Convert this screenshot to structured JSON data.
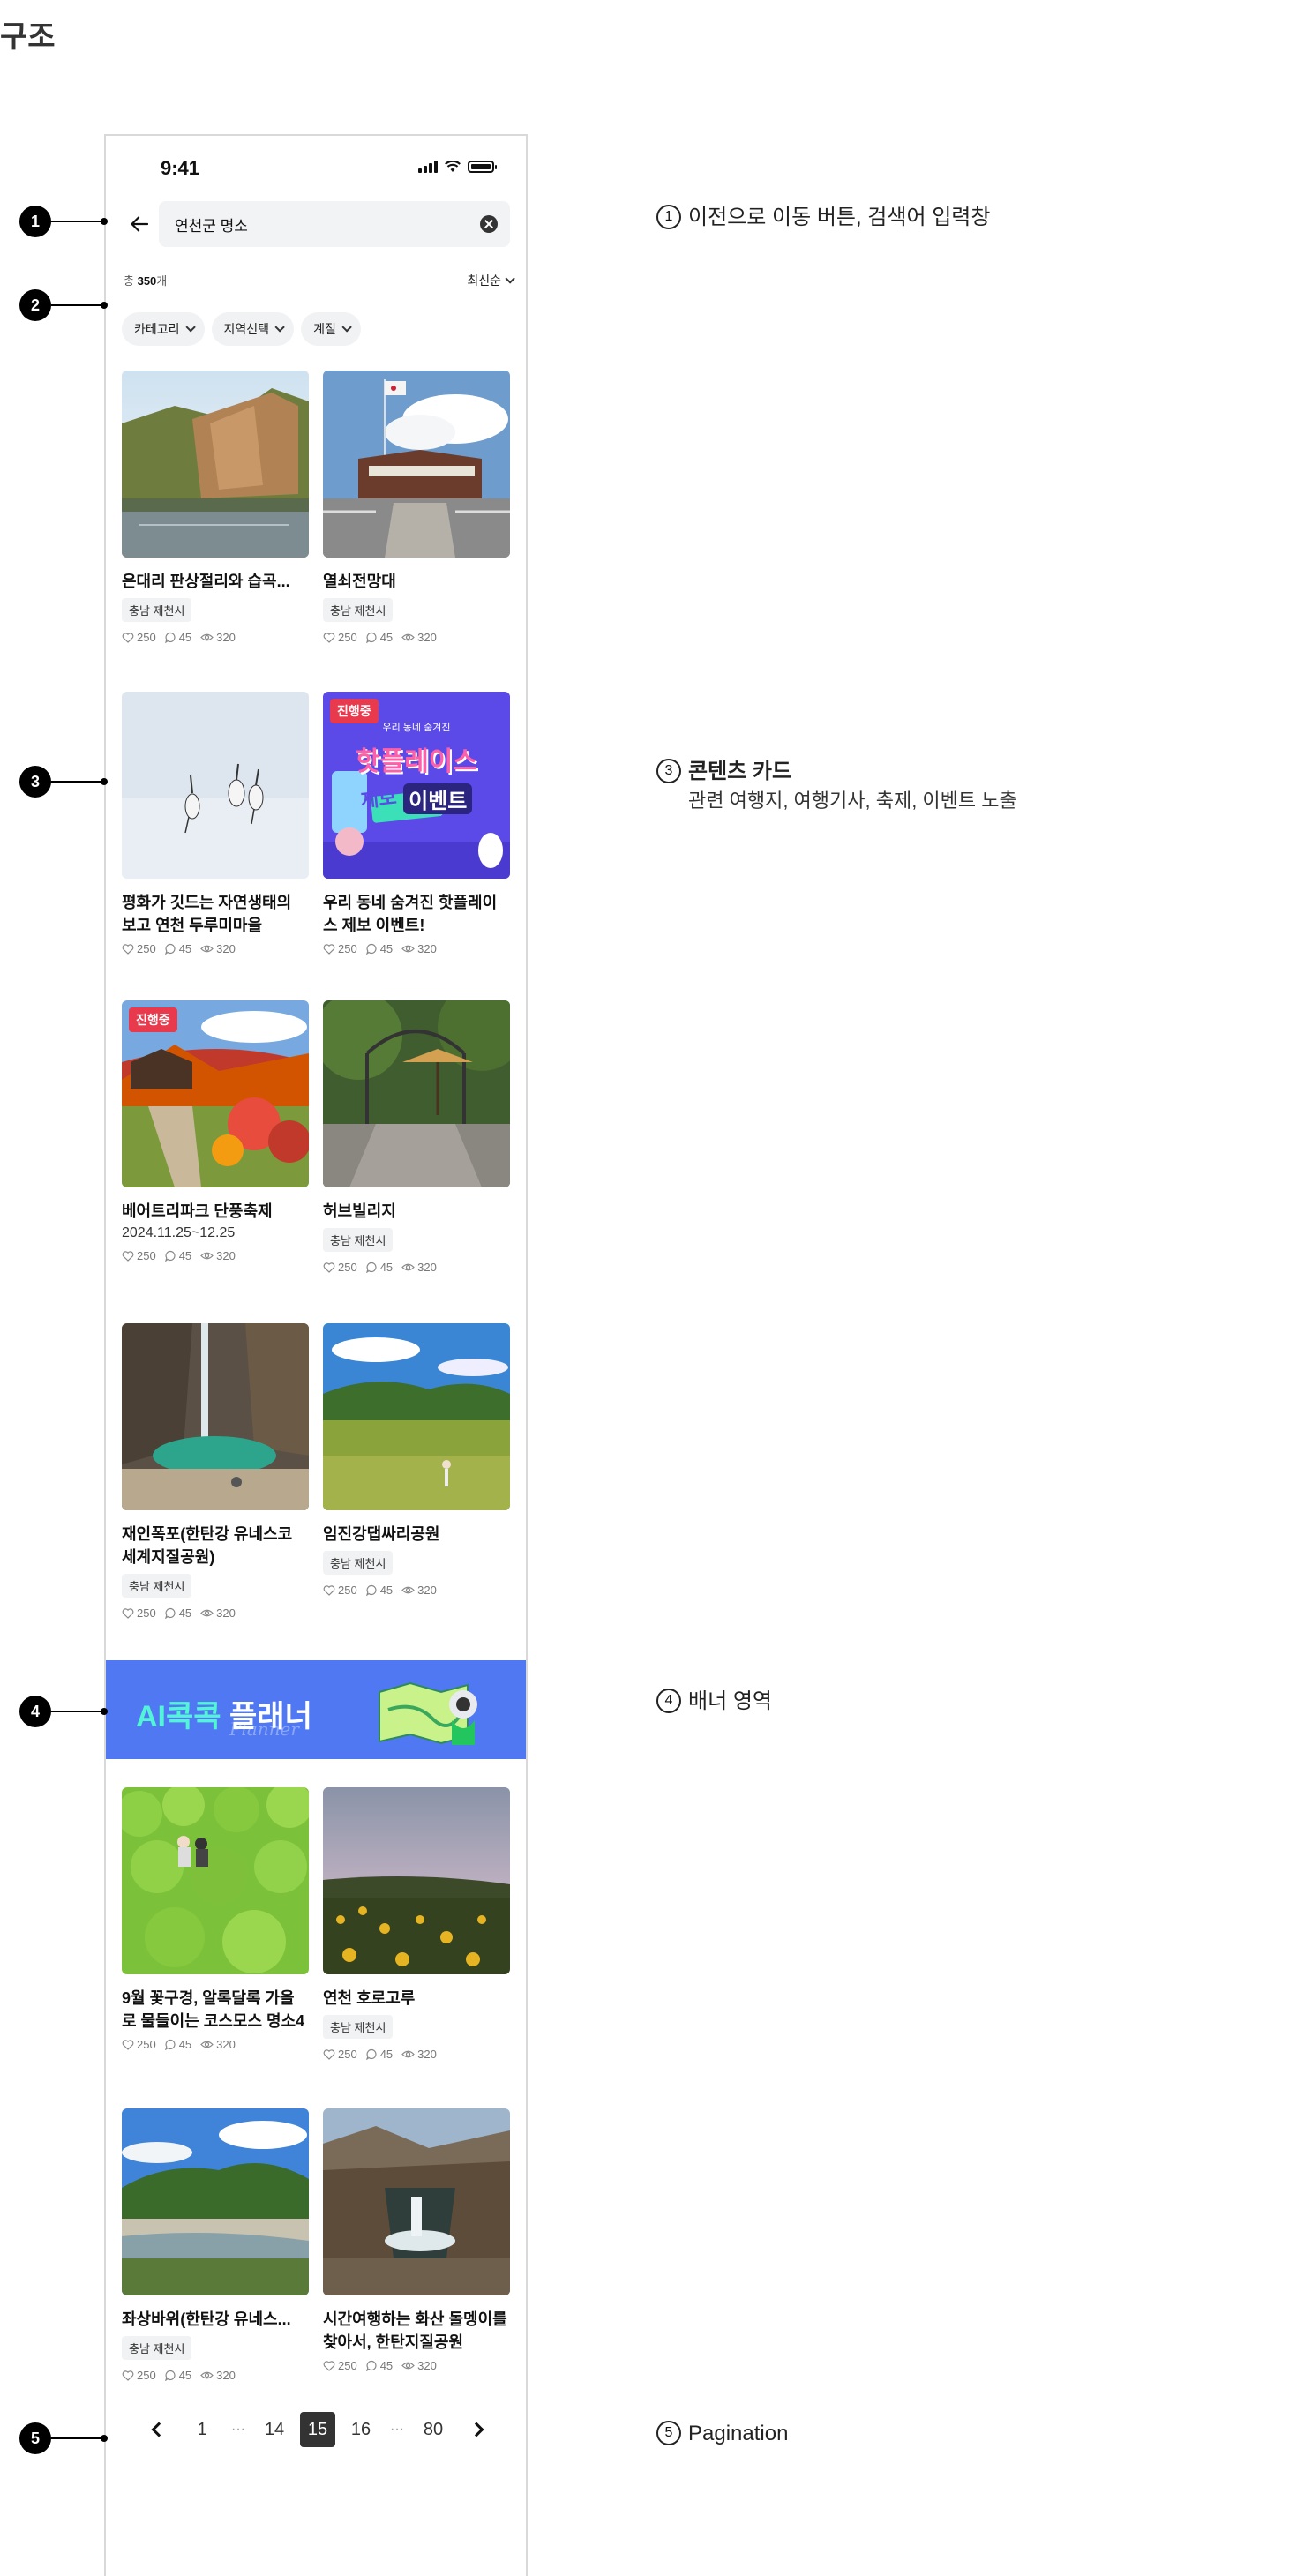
{
  "page": {
    "title": "구조"
  },
  "status_bar": {
    "time": "9:41"
  },
  "search": {
    "value": "연천군 명소"
  },
  "result": {
    "prefix": "총",
    "count": "350",
    "suffix": "개"
  },
  "sort": {
    "label": "최신순"
  },
  "filters": [
    {
      "label": "카테고리"
    },
    {
      "label": "지역선택"
    },
    {
      "label": "계절"
    }
  ],
  "cards": [
    {
      "title": "은대리 판상절리와 습곡...",
      "location": "충남 제천시",
      "likes": "250",
      "comments": "45",
      "views": "320"
    },
    {
      "title": "열쇠전망대",
      "location": "충남 제천시",
      "likes": "250",
      "comments": "45",
      "views": "320"
    },
    {
      "title": "평화가 깃드는 자연생태의 보고 연천 두루미마을",
      "likes": "250",
      "comments": "45",
      "views": "320"
    },
    {
      "title": "우리 동네 숨겨진 핫플레이스 제보 이벤트!",
      "badge": "진행중",
      "likes": "250",
      "comments": "45",
      "views": "320"
    },
    {
      "title": "베어트리파크 단풍축제",
      "date": "2024.11.25~12.25",
      "badge": "진행중",
      "likes": "250",
      "comments": "45",
      "views": "320"
    },
    {
      "title": "허브빌리지",
      "location": "충남 제천시",
      "likes": "250",
      "comments": "45",
      "views": "320"
    },
    {
      "title": "재인폭포(한탄강 유네스코 세계지질공원)",
      "location": "충남 제천시",
      "likes": "250",
      "comments": "45",
      "views": "320"
    },
    {
      "title": "임진강댑싸리공원",
      "location": "충남 제천시",
      "likes": "250",
      "comments": "45",
      "views": "320"
    },
    {
      "title": "9월 꽃구경, 알록달록 가을로 물들이는 코스모스 명소4",
      "likes": "250",
      "comments": "45",
      "views": "320"
    },
    {
      "title": "연천 호로고루",
      "location": "충남 제천시",
      "likes": "250",
      "comments": "45",
      "views": "320"
    },
    {
      "title": "좌상바위(한탄강 유네스...",
      "location": "충남 제천시",
      "likes": "250",
      "comments": "45",
      "views": "320"
    },
    {
      "title": "시간여행하는 화산 돌멩이를 찾아서, 한탄지질공원",
      "likes": "250",
      "comments": "45",
      "views": "320"
    }
  ],
  "event_art": {
    "small": "우리 동네 숨겨진",
    "big1": "핫플레이스",
    "big2": "제보",
    "big3": "이벤트"
  },
  "banner": {
    "ai": "AI콕콕",
    "text": "플래너",
    "script": "Planner"
  },
  "pagination": {
    "pages": [
      "1",
      "14",
      "15",
      "16",
      "80"
    ],
    "current": "15",
    "ellipsis": "···"
  },
  "callouts": [
    {
      "num": "1",
      "text": "이전으로 이동 버튼, 검색어 입력창"
    },
    {
      "num": "2"
    },
    {
      "num": "3",
      "text": "콘텐츠 카드",
      "sub": "관련 여행지, 여행기사, 축제, 이벤트 노출"
    },
    {
      "num": "4",
      "text": "배너 영역"
    },
    {
      "num": "5",
      "text": "Pagination"
    }
  ],
  "colors": {
    "badge": "#e8394d",
    "banner": "#4f78f2",
    "banner_ai": "#52f5d6",
    "event_bg": "#5b49e8"
  }
}
